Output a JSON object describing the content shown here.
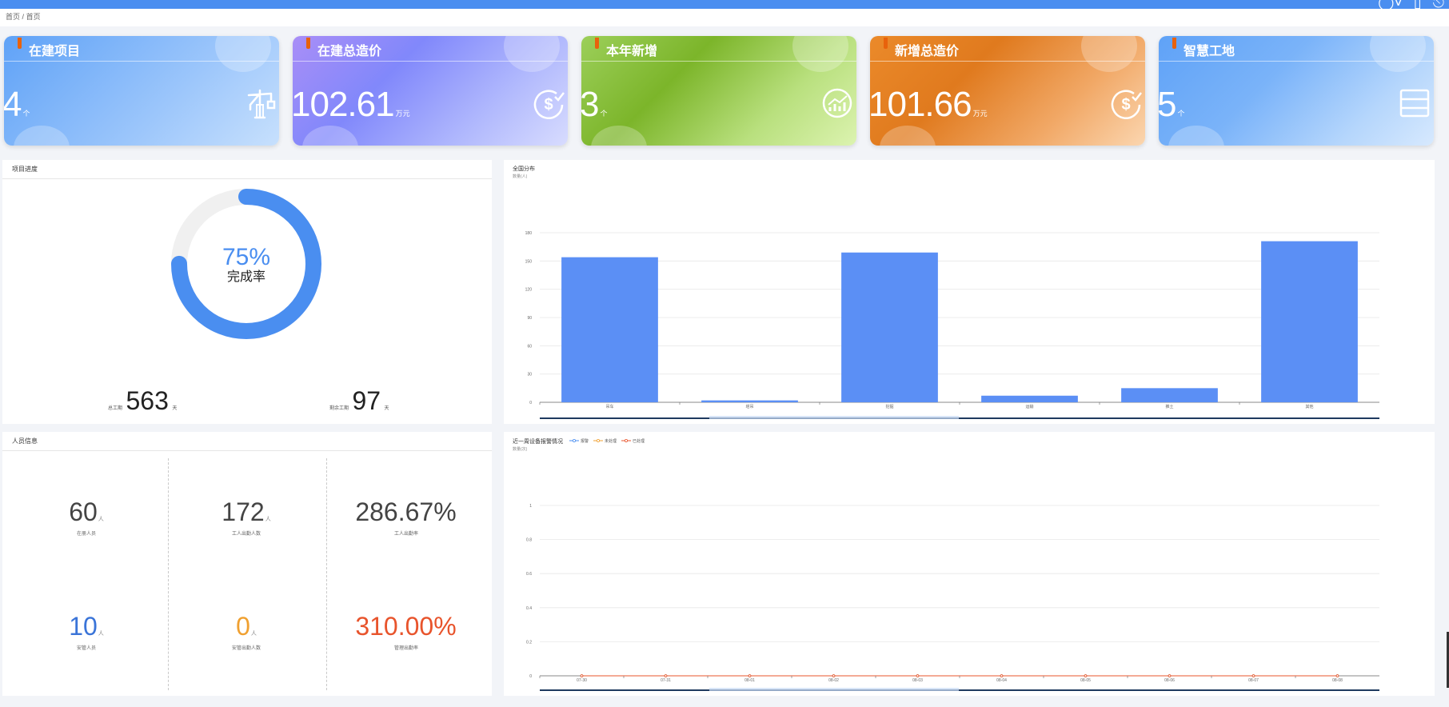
{
  "breadcrumb": {
    "home": "首页",
    "sep": "/",
    "current": "首页"
  },
  "cards": [
    {
      "title": "在建项目",
      "value": "4",
      "unit": "个",
      "icon": "crane-icon"
    },
    {
      "title": "在建总造价",
      "value": "102.61",
      "unit": "万元",
      "icon": "dollar-check-icon"
    },
    {
      "title": "本年新增",
      "value": "3",
      "unit": "个",
      "icon": "growth-chart-icon"
    },
    {
      "title": "新增总造价",
      "value": "101.66",
      "unit": "万元",
      "icon": "dollar-check-icon"
    },
    {
      "title": "智慧工地",
      "value": "5",
      "unit": "个",
      "icon": "server-icon"
    }
  ],
  "colors": {
    "blue": "#4a8ef0",
    "bar": "#5b8ff5",
    "orange": "#f0a030",
    "red": "#e8542c",
    "flag": "#e8620c"
  },
  "progress": {
    "title": "项目进度",
    "percent": "75%",
    "fraction": 0.75,
    "label": "完成率",
    "total_label": "总工期",
    "total_value": "563",
    "total_unit": "天",
    "remain_label": "剩余工期",
    "remain_value": "97",
    "remain_unit": "天"
  },
  "personnel": {
    "title": "人员信息",
    "stats": [
      {
        "value": "60",
        "unit": "人",
        "label": "在册人员"
      },
      {
        "value": "172",
        "unit": "人",
        "label": "工人出勤人数"
      },
      {
        "value": "286.67%",
        "unit": "",
        "label": "工人出勤率"
      },
      {
        "value": "10",
        "unit": "人",
        "label": "安管人员"
      },
      {
        "value": "0",
        "unit": "人",
        "label": "安管出勤人数"
      },
      {
        "value": "310.00%",
        "unit": "",
        "label": "管理出勤率"
      }
    ]
  },
  "chart_data": [
    {
      "type": "bar",
      "title": "全国分布",
      "subtitle": "数量(人)",
      "categories": [
        "吊车",
        "塔吊",
        "挖掘",
        "运输",
        "推土",
        "其他"
      ],
      "values": [
        154,
        2,
        159,
        7,
        15,
        171
      ],
      "ylim": [
        0,
        180
      ],
      "yticks": [
        0,
        30,
        60,
        90,
        120,
        150,
        180
      ],
      "grid": true
    },
    {
      "type": "line",
      "title": "近一周设备报警情况",
      "subtitle": "数量(次)",
      "legend": [
        "报警",
        "未处理",
        "已处理"
      ],
      "legend_position": "top-left",
      "x": [
        "07-30",
        "07-31",
        "08-01",
        "08-02",
        "08-03",
        "08-04",
        "08-05",
        "08-06",
        "08-07",
        "08-08"
      ],
      "series": [
        {
          "name": "报警",
          "values": [
            0,
            0,
            0,
            0,
            0,
            0,
            0,
            0,
            0,
            0
          ],
          "color": "#4a8ef0"
        },
        {
          "name": "未处理",
          "values": [
            0,
            0,
            0,
            0,
            0,
            0,
            0,
            0,
            0,
            0
          ],
          "color": "#f0a030"
        },
        {
          "name": "已处理",
          "values": [
            0,
            0,
            0,
            0,
            0,
            0,
            0,
            0,
            0,
            0
          ],
          "color": "#e8542c"
        }
      ],
      "ylim": [
        0,
        1
      ],
      "yticks": [
        0,
        0.2,
        0.4,
        0.6,
        0.8,
        1
      ],
      "grid": true
    }
  ]
}
